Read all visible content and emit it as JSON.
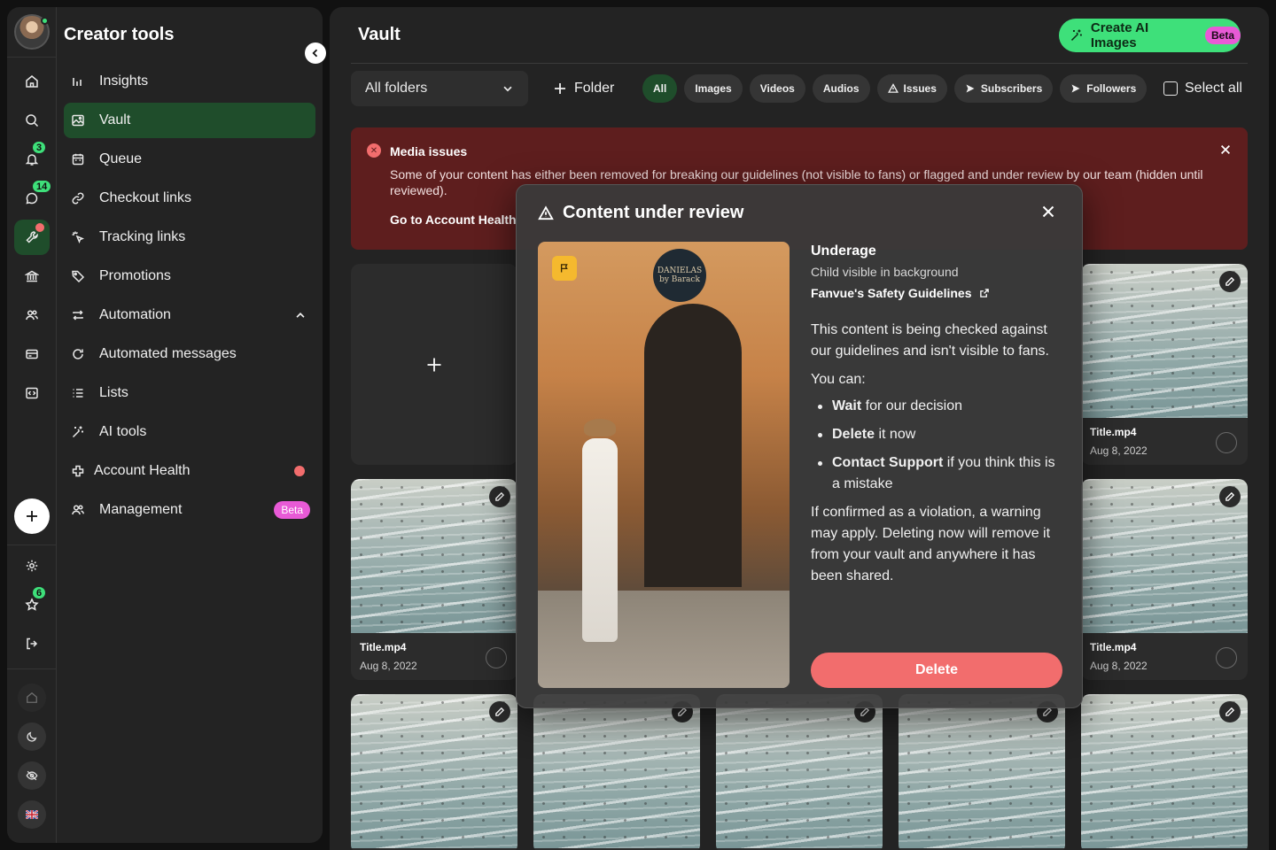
{
  "sidebar": {
    "title": "Creator tools",
    "rail_badges": {
      "notifications": "3",
      "messages": "14",
      "favorites": "6"
    },
    "items": [
      {
        "label": "Insights",
        "icon": "bar-chart-icon"
      },
      {
        "label": "Vault",
        "icon": "image-icon",
        "active": true
      },
      {
        "label": "Queue",
        "icon": "calendar-icon"
      },
      {
        "label": "Checkout links",
        "icon": "link-icon"
      },
      {
        "label": "Tracking links",
        "icon": "sparkle-click-icon"
      },
      {
        "label": "Promotions",
        "icon": "tag-icon"
      },
      {
        "label": "Automation",
        "icon": "repeat-icon"
      },
      {
        "label": "Automated messages",
        "icon": "refresh-icon"
      },
      {
        "label": "Lists",
        "icon": "list-icon"
      },
      {
        "label": "AI tools",
        "icon": "magic-icon"
      },
      {
        "label": "Account Health",
        "icon": "plus-cross-icon"
      },
      {
        "label": "Management",
        "icon": "users-icon",
        "badge": "Beta"
      }
    ]
  },
  "header": {
    "title": "Vault",
    "ai_button": "Create AI Images",
    "ai_badge": "Beta"
  },
  "toolbar": {
    "folder_select": "All folders",
    "folder_button": "Folder",
    "chips": [
      "All",
      "Images",
      "Videos",
      "Audios",
      "Issues",
      "Subscribers",
      "Followers"
    ],
    "select_all": "Select all"
  },
  "alert": {
    "title": "Media issues",
    "text": "Some of your content has either been removed for breaking our guidelines (not visible to fans) or flagged and under review by our team (hidden until reviewed).",
    "link": "Go to Account Health"
  },
  "cards": [
    {
      "name": "Title.mp4",
      "date": "Aug 8, 2022"
    },
    {
      "name": "Title.mp4",
      "date": "Aug 8, 2022"
    },
    {
      "name": "Title.mp4",
      "date": "Aug 8, 2022"
    }
  ],
  "modal": {
    "title": "Content under review",
    "photo_sign": "DANIELAS by Barack",
    "reason_title": "Underage",
    "reason_sub": "Child visible in background",
    "guidelines_link": "Fanvue's Safety Guidelines",
    "para1": "This content is being checked against our guidelines and isn't visible to fans.",
    "you_can": "You can:",
    "options": [
      {
        "bold": "Wait",
        "rest": " for our decision"
      },
      {
        "bold": "Delete",
        "rest": " it now"
      },
      {
        "bold": "Contact Support",
        "rest": " if you think this is a mistake"
      }
    ],
    "para2": "If confirmed as a violation, a warning may apply. Deleting now will remove it from your vault and anywhere it has been shared.",
    "delete_button": "Delete"
  },
  "colors": {
    "accent_green": "#3ee07a",
    "active_bg": "#1f4d2b",
    "danger": "#f26d6d",
    "beta_pink": "#e85ad6",
    "alert_bg": "#5e1e1e",
    "flag_yellow": "#f5b92e"
  }
}
